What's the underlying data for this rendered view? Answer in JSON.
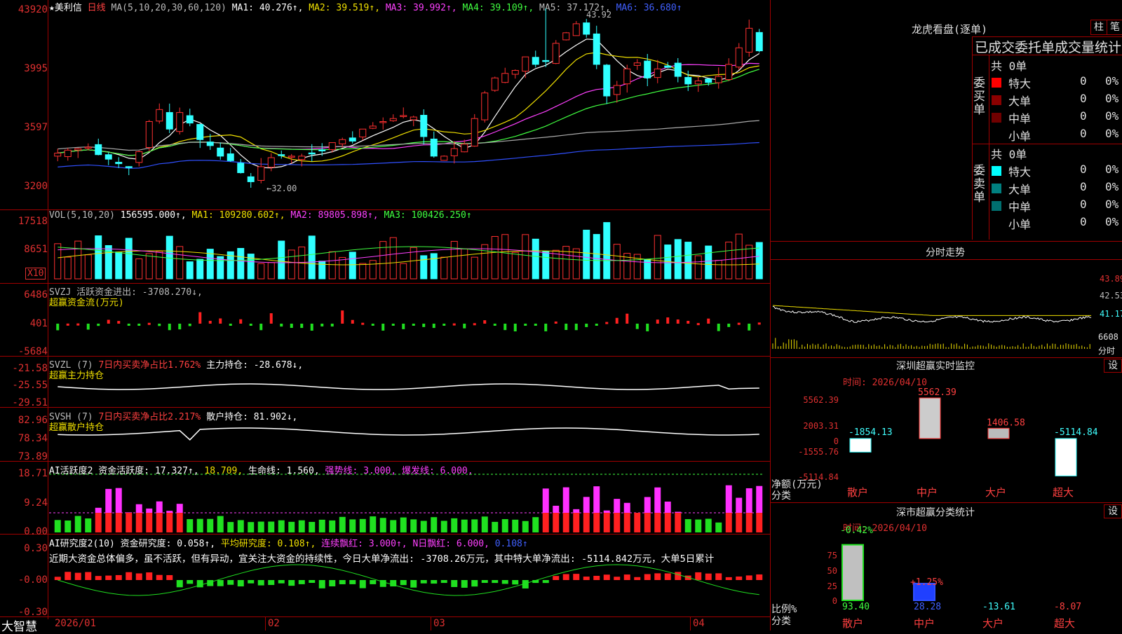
{
  "app_name": "大智慧",
  "stock": {
    "name": "★美利信",
    "period": "日线"
  },
  "ma_line": {
    "label": "MA(5,10,20,30,60,120)",
    "ma1": "MA1: 40.276↑,",
    "ma2": "MA2: 39.519↑,",
    "ma3": "MA3: 39.992↑,",
    "ma4": "MA4: 39.109↑,",
    "ma5": "MA5: 37.172↑,",
    "ma6": "MA6: 36.680↑"
  },
  "price_axis": [
    "43920",
    "3995",
    "3597",
    "3200"
  ],
  "price_annot": {
    "high": "43.92",
    "low": "←32.00"
  },
  "vol": {
    "label": "VOL(5,10,20)",
    "v": "156595.000↑,",
    "ma1": "MA1: 109280.602↑,",
    "ma2": "MA2: 89805.898↑,",
    "ma3": "MA3: 100426.250↑",
    "axis": [
      "17518",
      "8651"
    ],
    "unit": "X10"
  },
  "svzj": {
    "label": "SVZJ  活跃资金进出: -3708.270↓,",
    "sub": "超赢资金流(万元)",
    "axis": [
      "6486",
      "401",
      "-5684"
    ]
  },
  "svzl": {
    "label": "SVZL (7)",
    "ratio": "7日内买卖净占比1.762%",
    "hold": "主力持仓: -28.678↓,",
    "sub": "超赢主力持仓",
    "axis": [
      "-21.58",
      "-25.55",
      "-29.51"
    ]
  },
  "svsh": {
    "label": "SVSH (7)",
    "ratio": "7日内买卖净占比2.217%",
    "hold": "散户持仓: 81.902↓,",
    "sub": "超赢散户持仓",
    "axis": [
      "82.96",
      "78.34",
      "73.89"
    ]
  },
  "ai_active": {
    "label": "AI活跃度2 资金活跃度: 17.327↑,",
    "v2": "18.709,",
    "life": "生命线: 1.560,",
    "strong": "强势线: 3.000,",
    "burst": "爆发线: 6.000,",
    "axis": [
      "18.71",
      "9.24",
      "0.00"
    ]
  },
  "ai_research": {
    "label": "AI研究度2(10) 资金研究度: 0.058↑,",
    "avg": "平均研究度: 0.108↑,",
    "cont": "连续飘红: 3.000↑,",
    "nred": "N日飘红: 6.000,",
    "n2": "0.108↑",
    "comment": "近期大资金总体偏多，虽不活跃，但有异动，宜关注大资金的持续性，今日大单净流出: -3708.26万元，其中特大单净流出: -5114.842万元，大单5日累计",
    "axis": [
      "0.30",
      "-0.00",
      "-0.30"
    ]
  },
  "date_axis": [
    "2026/01",
    "02",
    "03",
    "04"
  ],
  "right": {
    "lhb_title": "龙虎看盘(逐单)",
    "btn1": "柱",
    "btn2": "笔",
    "tabs": "已成交委托单成交量统计",
    "buy_total": "共 0单",
    "buy_side": "委买单",
    "sell_total": "共 0单",
    "sell_side": "委卖单",
    "rows": [
      "特大",
      "大单",
      "中单",
      "小单"
    ],
    "zero": "0",
    "pct": "0%",
    "fenshi_title": "分时走势",
    "fenshi_axis": [
      "43.89",
      "42.53",
      "41.17",
      "6608",
      "分时"
    ],
    "monitor_title": "深圳超赢实时监控",
    "set": "设",
    "monitor_time": "时间: 2026/04/10",
    "monitor_axis": [
      "5562.39",
      "2003.31",
      "0",
      "-1555.76",
      "-5114.84"
    ],
    "monitor_vals": [
      "-1854.13",
      "5562.39",
      "1406.58",
      "-5114.84"
    ],
    "monitor_ylabel": "净额(万元)",
    "monitor_xlabel": "分类",
    "cats": [
      "散户",
      "中户",
      "大户",
      "超大"
    ],
    "class_title": "深市超赢分类统计",
    "class_time": "时间: 2026/04/10",
    "class_axis": [
      "75",
      "50",
      "25",
      "0"
    ],
    "class_pct": [
      "-0.42%",
      "+1.25%"
    ],
    "class_vals": [
      "93.40",
      "28.28",
      "-13.61",
      "-8.07"
    ],
    "class_ylabel": "比例%",
    "class_xlabel": "分类"
  },
  "chart_data": [
    {
      "type": "candlestick",
      "title": "美利信 日线",
      "ohlc_note": "daily candles 2026/01 - 2026/04",
      "ylim": [
        32.0,
        43.92
      ],
      "high": 43.92,
      "low": 32.0,
      "closes": [
        34.3,
        34.5,
        34.6,
        34.7,
        34.2,
        33.9,
        33.6,
        33.4,
        34.4,
        36.4,
        37.2,
        35.9,
        37.0,
        36.3,
        35.2,
        34.8,
        34.1,
        33.8,
        33.0,
        32.4,
        33.4,
        34.0,
        34.2,
        34.1,
        34.1,
        34.3,
        34.5,
        35.0,
        35.2,
        35.1,
        35.9,
        36.1,
        36.4,
        36.6,
        36.8,
        36.7,
        35.4,
        34.1,
        34.1,
        34.6,
        34.9,
        36.6,
        38.3,
        39.3,
        39.6,
        39.8,
        40.7,
        40.2,
        40.4,
        41.6,
        42.3,
        42.9,
        42.2,
        40.2,
        38.1,
        38.8,
        39.9,
        40.3,
        39.3,
        39.9,
        40.0,
        39.4,
        38.9,
        39.1,
        39.0,
        39.4,
        40.2,
        41.3,
        42.6,
        41.1
      ]
    },
    {
      "type": "bar",
      "title": "VOL",
      "ylim": [
        0,
        17518
      ]
    },
    {
      "type": "bar",
      "title": "超赢资金流(万元)",
      "ylim": [
        -5684,
        6486
      ]
    },
    {
      "type": "line",
      "title": "超赢主力持仓",
      "ylim": [
        -29.51,
        -21.58
      ]
    },
    {
      "type": "line",
      "title": "超赢散户持仓",
      "ylim": [
        73.89,
        82.96
      ]
    },
    {
      "type": "bar",
      "title": "AI活跃度2",
      "ylim": [
        0,
        18.71
      ]
    },
    {
      "type": "bar",
      "title": "AI研究度2",
      "ylim": [
        -0.3,
        0.3
      ]
    },
    {
      "type": "bar",
      "title": "深圳超赢实时监控",
      "categories": [
        "散户",
        "中户",
        "大户",
        "超大"
      ],
      "values": [
        -1854.13,
        5562.39,
        1406.58,
        -5114.84
      ],
      "ylabel": "净额(万元)",
      "xlabel": "分类"
    },
    {
      "type": "bar",
      "title": "深市超赢分类统计",
      "categories": [
        "散户",
        "中户",
        "大户",
        "超大"
      ],
      "values": [
        93.4,
        28.28,
        -13.61,
        -8.07
      ],
      "ylabel": "比例%",
      "xlabel": "分类"
    }
  ]
}
